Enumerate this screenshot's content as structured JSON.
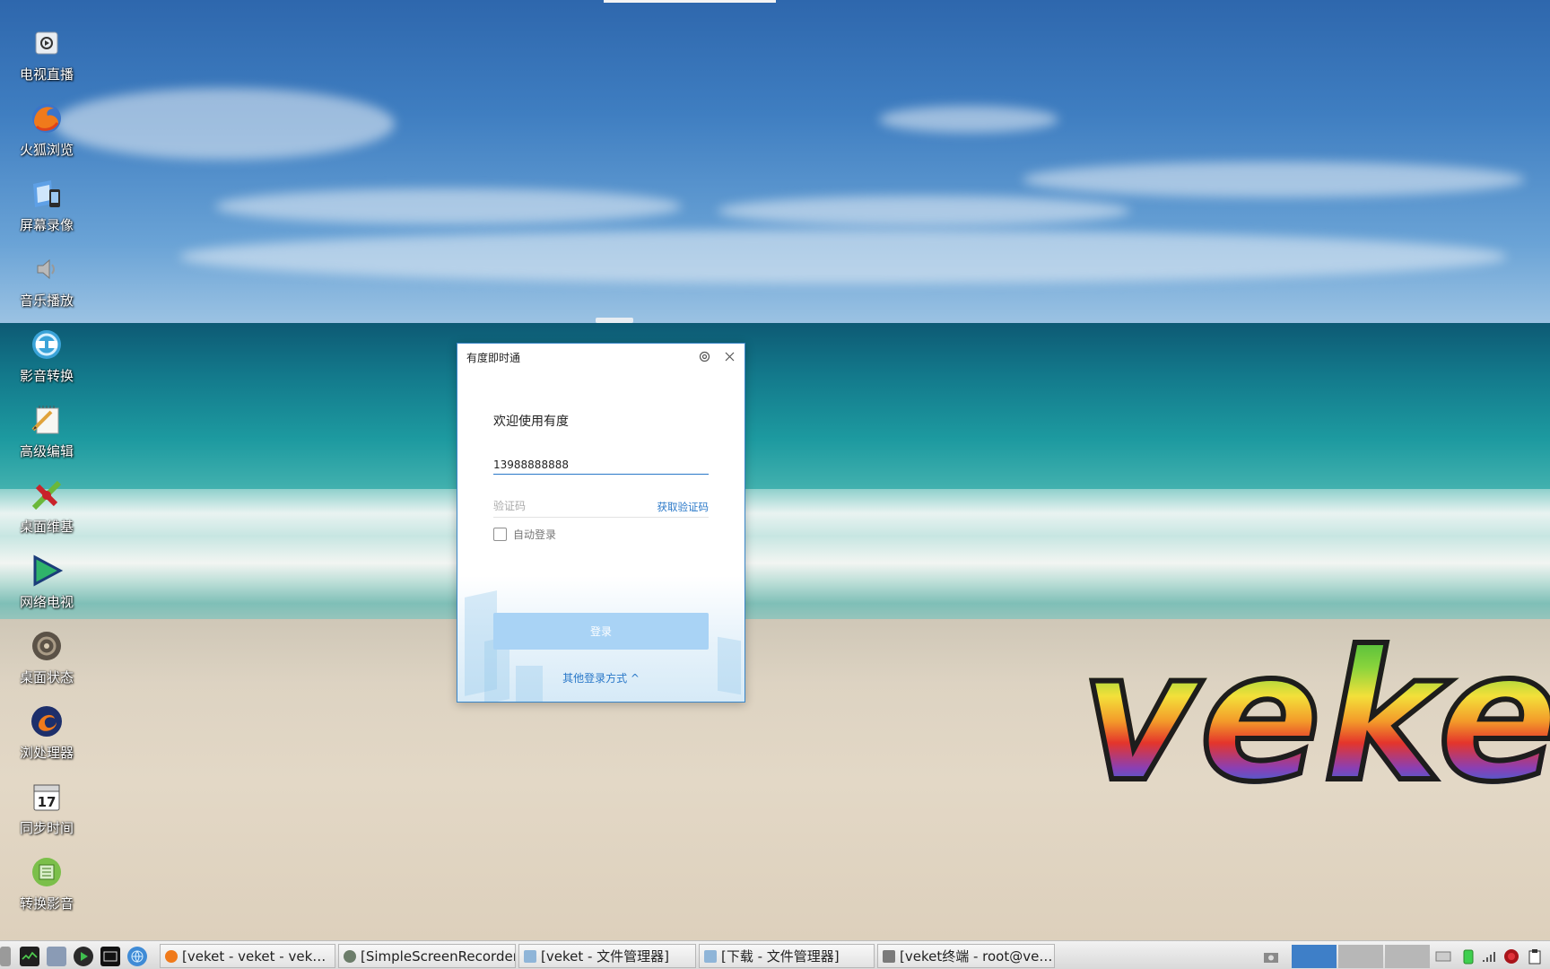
{
  "desktop_icons": [
    {
      "label": "电视直播",
      "icon": "tv-icon"
    },
    {
      "label": "火狐浏览",
      "icon": "firefox-icon"
    },
    {
      "label": "屏幕录像",
      "icon": "screen-recorder-icon"
    },
    {
      "label": "音乐播放",
      "icon": "speaker-icon"
    },
    {
      "label": "影音转换",
      "icon": "media-convert-icon"
    },
    {
      "label": "高级编辑",
      "icon": "notepad-icon"
    },
    {
      "label": "桌面维基",
      "icon": "wiki-icon"
    },
    {
      "label": "网络电视",
      "icon": "play-icon"
    },
    {
      "label": "桌面状态",
      "icon": "status-icon"
    },
    {
      "label": "浏处理器",
      "icon": "processor-icon"
    },
    {
      "label": "同步时间",
      "icon": "calendar-icon"
    },
    {
      "label": "转换影音",
      "icon": "convert-icon"
    }
  ],
  "wallpaper": {
    "logo_text": "veket"
  },
  "dialog": {
    "title": "有度即时通",
    "welcome": "欢迎使用有度",
    "phone_value": "13988888888",
    "code_placeholder": "验证码",
    "get_code_label": "获取验证码",
    "auto_login_label": "自动登录",
    "auto_login_checked": false,
    "login_button_label": "登录",
    "other_login_label": "其他登录方式 ^",
    "accent_color": "#2a78c8",
    "button_color": "#a9d3f5"
  },
  "taskbar": {
    "quick_launch": [
      "menu-icon",
      "system-monitor-icon",
      "settings-icon",
      "media-icon",
      "terminal-icon",
      "globe-icon"
    ],
    "tasks": [
      {
        "label": "[veket - veket - vek…",
        "icon": "firefox-icon"
      },
      {
        "label": "[SimpleScreenRecorder]",
        "icon": "recorder-icon"
      },
      {
        "label": "[veket - 文件管理器]",
        "icon": "folder-icon"
      },
      {
        "label": "[下载 - 文件管理器]",
        "icon": "folder-icon"
      },
      {
        "label": "[veket终端 - root@ve…",
        "icon": "terminal-icon"
      }
    ],
    "active_desktop": 1,
    "desktops": 3
  }
}
